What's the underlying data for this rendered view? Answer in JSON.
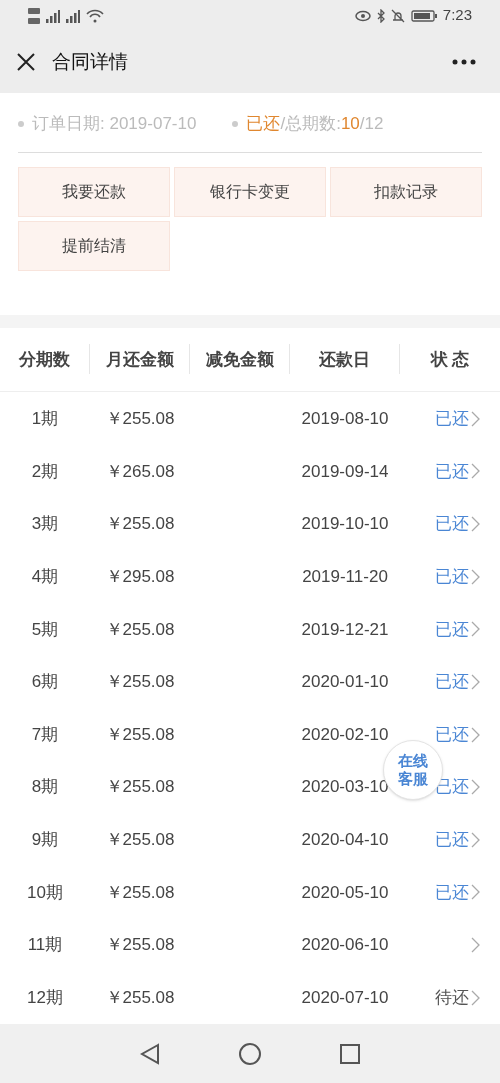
{
  "status_bar": {
    "time": "7:23"
  },
  "header": {
    "title": "合同详情"
  },
  "summary": {
    "order_date_label": "订单日期: ",
    "order_date": "2019-07-10",
    "paid_label": "已还",
    "total_label": "/总期数: ",
    "paid_count": "10",
    "total_count": "/12"
  },
  "actions": [
    "我要还款",
    "银行卡变更",
    "扣款记录",
    "提前结清"
  ],
  "table": {
    "columns": [
      "分期数",
      "月还金额",
      "减免金额",
      "还款日",
      "状 态"
    ],
    "rows": [
      {
        "period": "1期",
        "amount": "￥255.08",
        "date": "2019-08-10",
        "status": "已还",
        "color": "#4a86d4"
      },
      {
        "period": "2期",
        "amount": "￥265.08",
        "date": "2019-09-14",
        "status": "已还",
        "color": "#4a86d4"
      },
      {
        "period": "3期",
        "amount": "￥255.08",
        "date": "2019-10-10",
        "status": "已还",
        "color": "#4a86d4"
      },
      {
        "period": "4期",
        "amount": "￥295.08",
        "date": "2019-11-20",
        "status": "已还",
        "color": "#4a86d4"
      },
      {
        "period": "5期",
        "amount": "￥255.08",
        "date": "2019-12-21",
        "status": "已还",
        "color": "#4a86d4"
      },
      {
        "period": "6期",
        "amount": "￥255.08",
        "date": "2020-01-10",
        "status": "已还",
        "color": "#4a86d4"
      },
      {
        "period": "7期",
        "amount": "￥255.08",
        "date": "2020-02-10",
        "status": "已还",
        "color": "#4a86d4"
      },
      {
        "period": "8期",
        "amount": "￥255.08",
        "date": "2020-03-10",
        "status": "已还",
        "color": "#4a86d4"
      },
      {
        "period": "9期",
        "amount": "￥255.08",
        "date": "2020-04-10",
        "status": "已还",
        "color": "#4a86d4"
      },
      {
        "period": "10期",
        "amount": "￥255.08",
        "date": "2020-05-10",
        "status": "已还",
        "color": "#4a86d4"
      },
      {
        "period": "11期",
        "amount": "￥255.08",
        "date": "2020-06-10"
      },
      {
        "period": "12期",
        "amount": "￥255.08",
        "date": "2020-07-10",
        "status": "待还",
        "color": "#555555"
      }
    ]
  },
  "chat_button": {
    "label": "在线客服"
  }
}
